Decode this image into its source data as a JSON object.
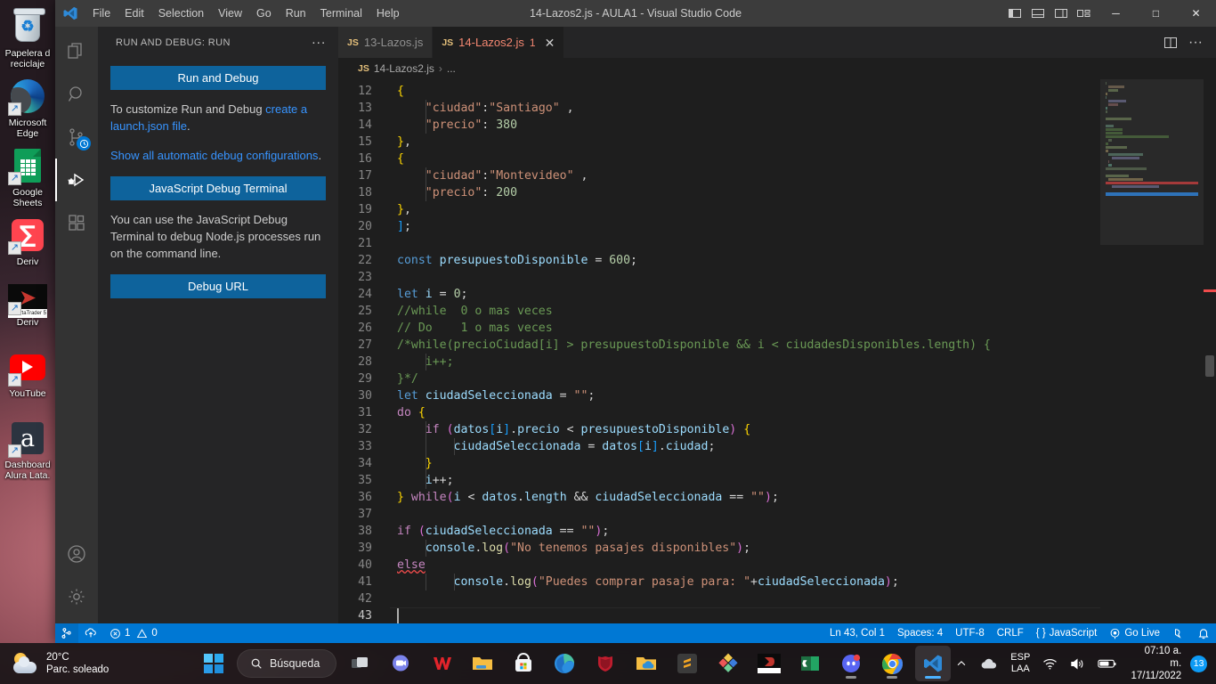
{
  "desktop": {
    "icons": [
      {
        "name": "recycle-bin",
        "label": "Papelera d\nreciclaje"
      },
      {
        "name": "microsoft-edge",
        "label": "Microsoft\nEdge"
      },
      {
        "name": "google-sheets",
        "label": "Google\nSheets"
      },
      {
        "name": "deriv",
        "label": "Deriv"
      },
      {
        "name": "deriv-metatrader",
        "label": "Deriv",
        "caption": "rtaTrader 5"
      },
      {
        "name": "youtube",
        "label": "YouTube"
      },
      {
        "name": "alura-dashboard",
        "label": "Dashboard\nAlura Lata."
      }
    ]
  },
  "vscode": {
    "window_title": "14-Lazos2.js - AULA1 - Visual Studio Code",
    "menu": [
      "File",
      "Edit",
      "Selection",
      "View",
      "Go",
      "Run",
      "Terminal",
      "Help"
    ],
    "titlebar_buttons": {
      "toggle_primary_sidebar": "toggle-primary-sidebar-icon",
      "toggle_panel": "toggle-panel-icon",
      "toggle_secondary_sidebar": "toggle-secondary-sidebar-icon",
      "customize_layout": "customize-layout-icon",
      "minimize": "─",
      "maximize": "□",
      "close": "✕"
    },
    "activitybar": [
      {
        "name": "explorer",
        "icon": "files-icon",
        "active": false
      },
      {
        "name": "search",
        "icon": "search-icon",
        "active": false
      },
      {
        "name": "source-control",
        "icon": "source-control-icon",
        "active": false,
        "badge": "clock-badge"
      },
      {
        "name": "run-and-debug",
        "icon": "run-and-debug-icon",
        "active": true
      },
      {
        "name": "extensions",
        "icon": "extensions-icon",
        "active": false
      },
      {
        "name": "accounts",
        "icon": "accounts-icon",
        "active": false
      },
      {
        "name": "manage-settings",
        "icon": "gear-icon",
        "active": false
      }
    ],
    "sidebar": {
      "title": "RUN AND DEBUG: RUN",
      "more_actions": "···",
      "run_and_debug_button": "Run and Debug",
      "customize_text_1": "To customize Run and Debug ",
      "customize_link": "create a launch.json file",
      "customize_text_2": ".",
      "show_all_link": "Show all automatic debug configurations",
      "show_all_suffix": ".",
      "js_debug_terminal_button": "JavaScript Debug Terminal",
      "js_debug_help": "You can use the JavaScript Debug Terminal to debug Node.js processes run on the command line.",
      "debug_url_button": "Debug URL"
    },
    "tabs": [
      {
        "label": "13-Lazos.js",
        "icon": "js-file-icon",
        "icon_text": "JS",
        "active": false,
        "badge": "",
        "has_error": false
      },
      {
        "label": "14-Lazos2.js",
        "icon": "js-file-icon",
        "icon_text": "JS",
        "active": true,
        "badge": "1",
        "has_error": true,
        "close": "✕"
      }
    ],
    "editor_actions": {
      "split_editor": "split-editor-icon",
      "more_actions": "···"
    },
    "breadcrumbs": {
      "icon_text": "JS",
      "file": "14-Lazos2.js",
      "separator": "›",
      "rest": "..."
    },
    "editor": {
      "first_line_number": 12,
      "lines": [
        "{",
        "    \"ciudad\":\"Santiago\" ,",
        "    \"precio\": 380",
        "},",
        "{",
        "    \"ciudad\":\"Montevideo\" ,",
        "    \"precio\": 200",
        "},",
        "];",
        "",
        "const presupuestoDisponible = 600;",
        "",
        "let i = 0;",
        "//while  0 o mas veces",
        "// Do    1 o mas veces",
        "/*while(precioCiudad[i] > presupuestoDisponible && i < ciudadesDisponibles.length) {",
        "    i++;",
        "}*/",
        "let ciudadSeleccionada = \"\";",
        "do {",
        "    if (datos[i].precio < presupuestoDisponible) {",
        "        ciudadSeleccionada = datos[i].ciudad;",
        "    }",
        "    i++;",
        "} while(i < datos.length && ciudadSeleccionada == \"\");",
        "",
        "if (ciudadSeleccionada == \"\");",
        "    console.log(\"No tenemos pasajes disponibles\");",
        "else",
        "        console.log(\"Puedes comprar pasaje para: \"+ciudadSeleccionada);",
        "",
        ""
      ],
      "cursor_line": 43
    },
    "statusbar": {
      "remote_icon": "remote-window-icon",
      "branch_icon": "source-control-branch-icon",
      "sync_icon": "sync-changes-icon",
      "errors_icon": "error-icon",
      "errors": "1",
      "warnings_icon": "warning-icon",
      "warnings": "0",
      "position": "Ln 43, Col 1",
      "indentation": "Spaces: 4",
      "encoding": "UTF-8",
      "eol": "CRLF",
      "language_icon": "{ }",
      "language": "JavaScript",
      "go_live_icon": "broadcast-icon",
      "go_live": "Go Live",
      "feedback_icon": "feedback-smiley-icon",
      "bell_icon": "bell-dot-icon"
    }
  },
  "taskbar": {
    "weather": {
      "temperature": "20°C",
      "condition": "Parc. soleado",
      "icon": "partly-sunny-icon"
    },
    "start_button": "windows-start-icon",
    "search": {
      "icon": "search-icon",
      "label": "Búsqueda"
    },
    "apps": [
      {
        "name": "task-view",
        "icon": "task-view-icon"
      },
      {
        "name": "microsoft-teams",
        "icon": "teams-chat-icon"
      },
      {
        "name": "wps-office",
        "icon": "wps-icon"
      },
      {
        "name": "file-explorer",
        "icon": "folder-icon"
      },
      {
        "name": "microsoft-store",
        "icon": "store-icon"
      },
      {
        "name": "microsoft-edge",
        "icon": "edge-icon"
      },
      {
        "name": "mcafee",
        "icon": "mcafee-shield-icon"
      },
      {
        "name": "onedrive-folder",
        "icon": "onedrive-folder-icon"
      },
      {
        "name": "sublime-text",
        "icon": "sublime-icon"
      },
      {
        "name": "paint-3d",
        "icon": "paint3d-icon"
      },
      {
        "name": "deriv-metatrader",
        "icon": "deriv-mt5-icon"
      },
      {
        "name": "microsoft-excel",
        "icon": "excel-icon"
      },
      {
        "name": "discord",
        "icon": "discord-icon",
        "running": true
      },
      {
        "name": "google-chrome",
        "icon": "chrome-icon",
        "running": true
      },
      {
        "name": "visual-studio-code",
        "icon": "vscode-icon",
        "running": true,
        "focused": true
      }
    ],
    "tray": {
      "overflow_icon": "chevron-up-icon",
      "cloud_icon": "cloud-icon",
      "language_line1": "ESP",
      "language_line2": "LAA",
      "wifi_icon": "wifi-icon",
      "volume_icon": "speaker-icon",
      "battery_icon": "battery-icon",
      "time": "07:10 a. m.",
      "date": "17/11/2022",
      "notification_count": "13"
    }
  }
}
